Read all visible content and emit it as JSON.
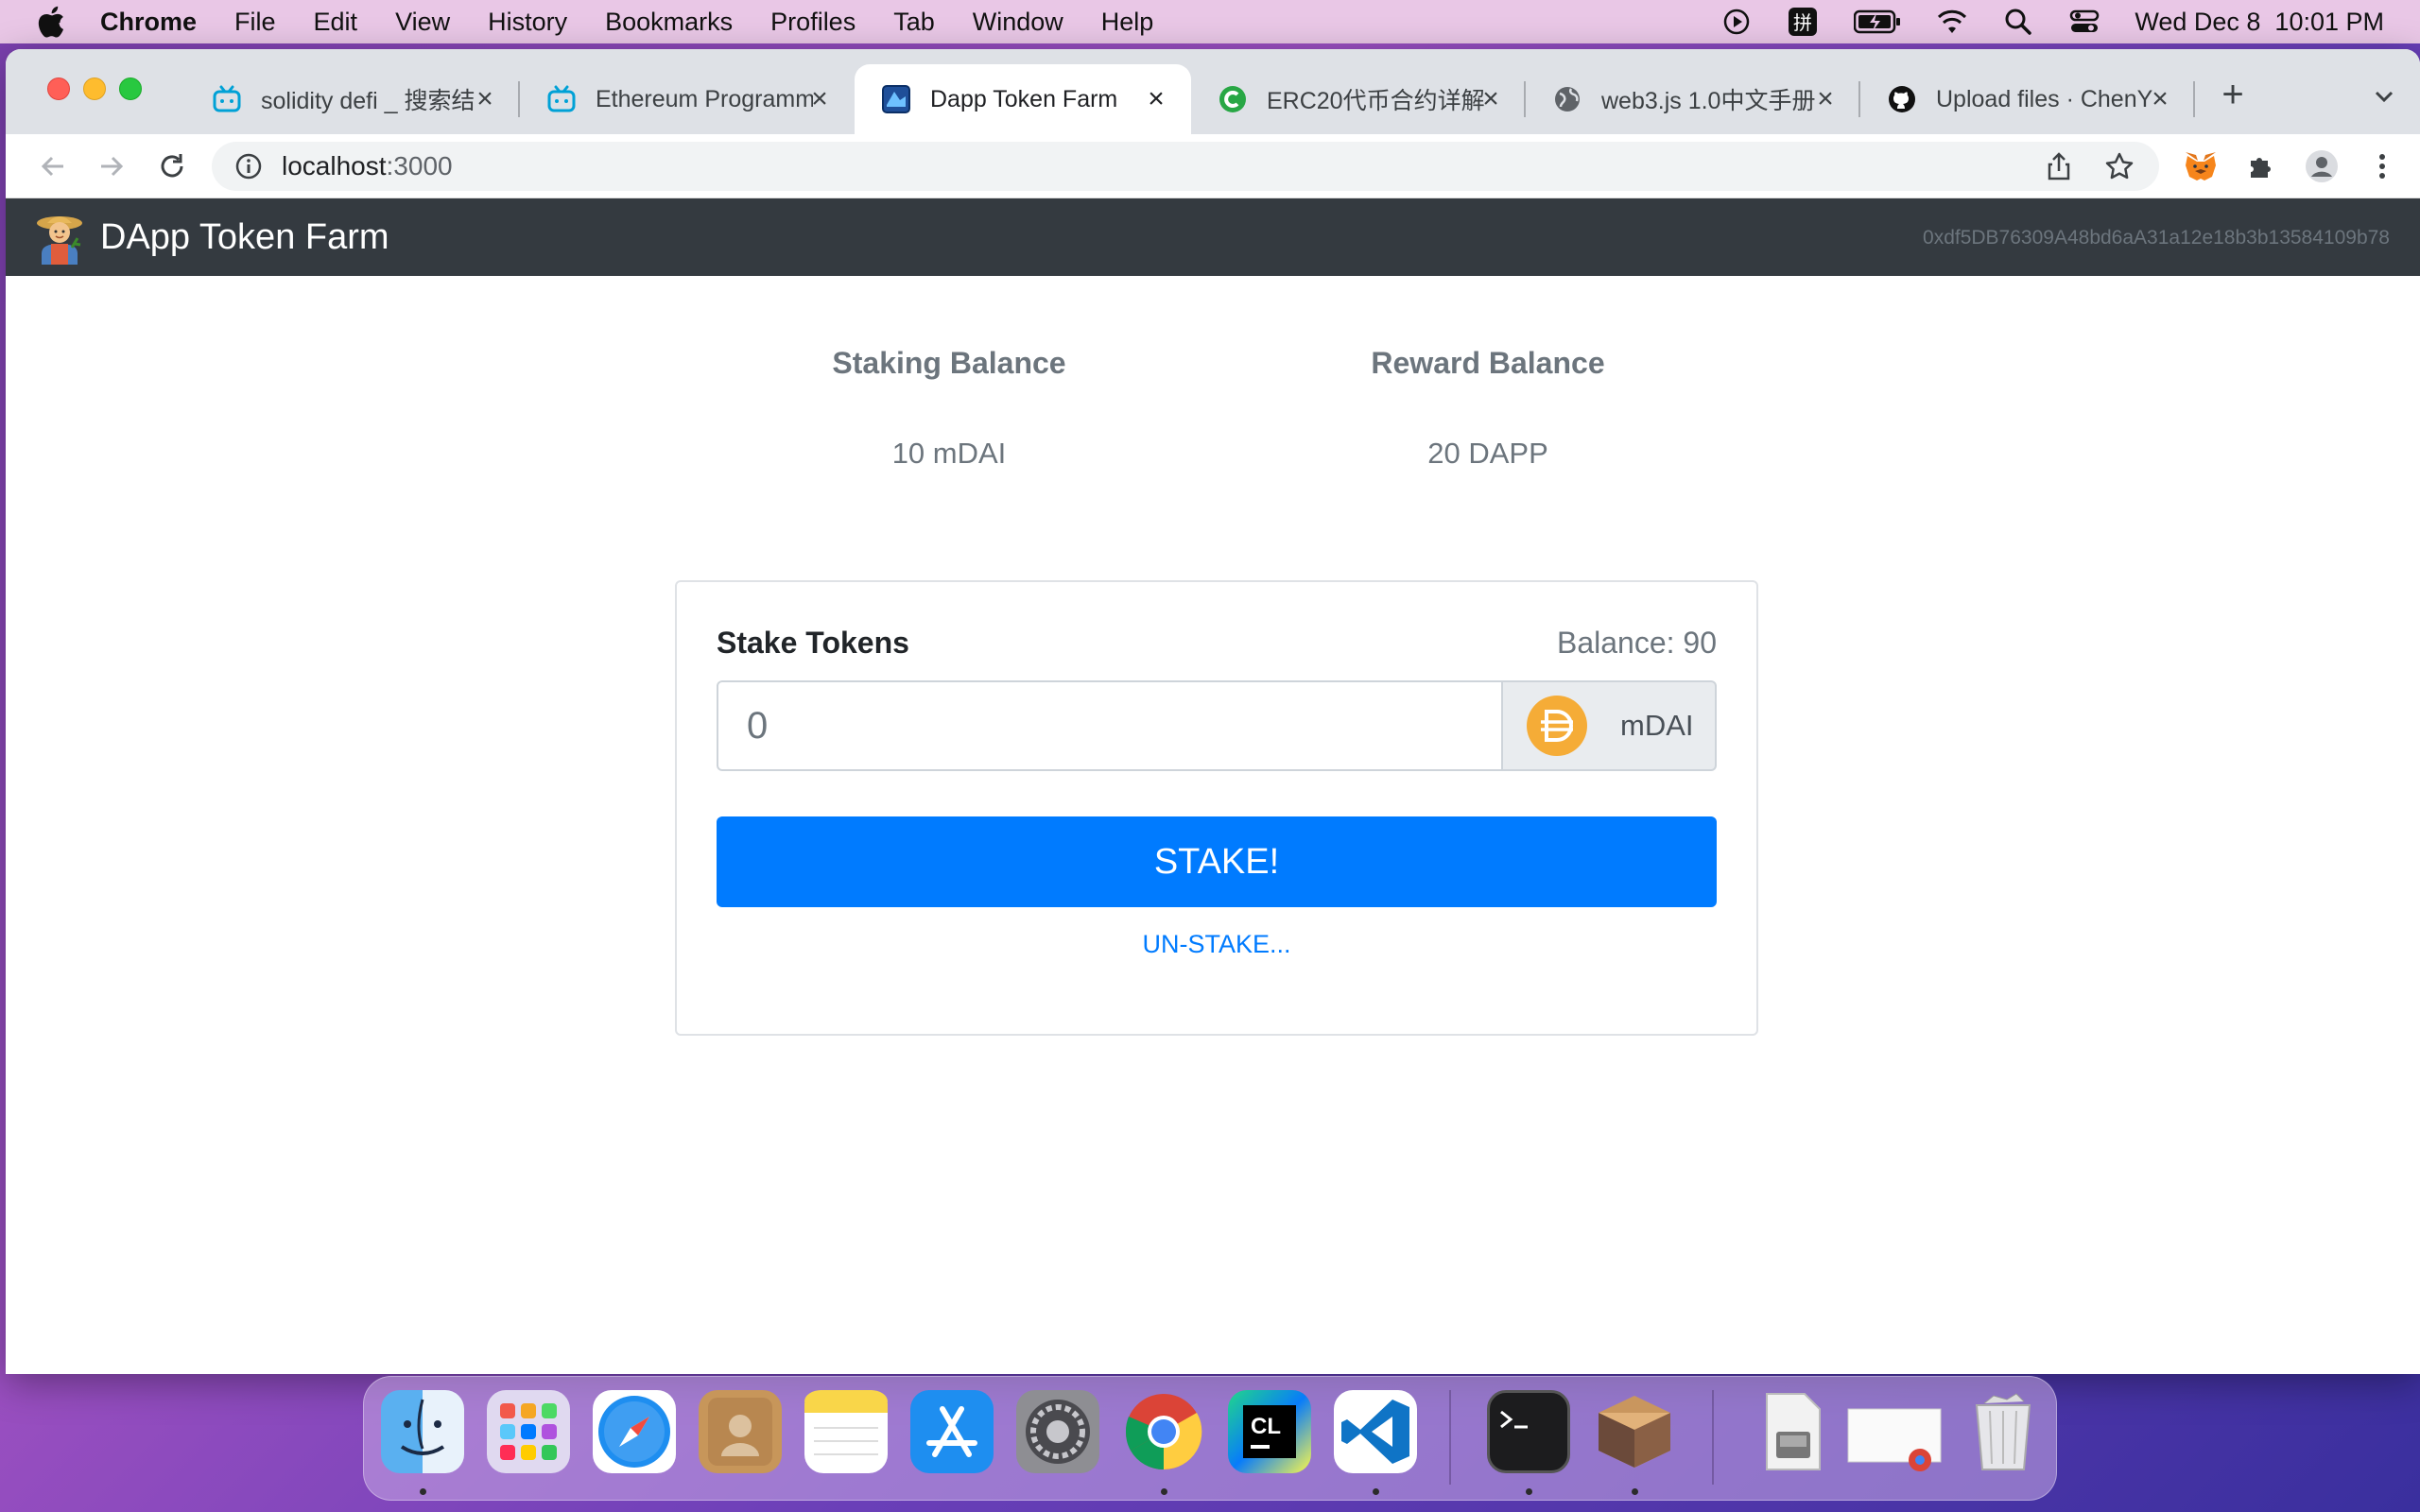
{
  "menubar": {
    "app": "Chrome",
    "items": [
      "File",
      "Edit",
      "View",
      "History",
      "Bookmarks",
      "Profiles",
      "Tab",
      "Window",
      "Help"
    ],
    "datetime": "Wed Dec 8  10:01 PM"
  },
  "browser": {
    "tabs": [
      {
        "label": "solidity defi _ 搜索结",
        "icon": "bilibili-icon"
      },
      {
        "label": "Ethereum Programm",
        "icon": "bilibili-icon"
      },
      {
        "label": "Dapp Token Farm",
        "icon": "dapp-icon",
        "active": true
      },
      {
        "label": "ERC20代币合约详解",
        "icon": "c-icon"
      },
      {
        "label": "web3.js 1.0中文手册",
        "icon": "globe-icon"
      },
      {
        "label": "Upload files · ChenY",
        "icon": "github-icon"
      }
    ],
    "url_host": "localhost",
    "url_port": ":3000"
  },
  "app": {
    "brand": "DApp Token Farm",
    "account": "0xdf5DB76309A48bd6aA31a12e18b3b13584109b78",
    "staking_label": "Staking Balance",
    "staking_value": "10 mDAI",
    "reward_label": "Reward Balance",
    "reward_value": "20 DAPP",
    "form": {
      "title": "Stake Tokens",
      "balance": "Balance: 90",
      "placeholder": "0",
      "unit": "mDAI",
      "stake_button": "STAKE!",
      "unstake_link": "UN-STAKE..."
    }
  },
  "dock": {
    "apps": [
      "finder-icon",
      "launchpad-icon",
      "safari-icon",
      "contacts-icon",
      "notes-icon",
      "app-store-icon",
      "system-preferences-icon",
      "chrome-icon",
      "clion-icon",
      "vscode-icon",
      "terminal-icon",
      "box-app-icon",
      "disk-image-icon",
      "chrome-window-icon",
      "trash-icon"
    ]
  },
  "colors": {
    "navbar": "#343a40",
    "primary": "#007bff",
    "dai": "#f5ac37"
  }
}
